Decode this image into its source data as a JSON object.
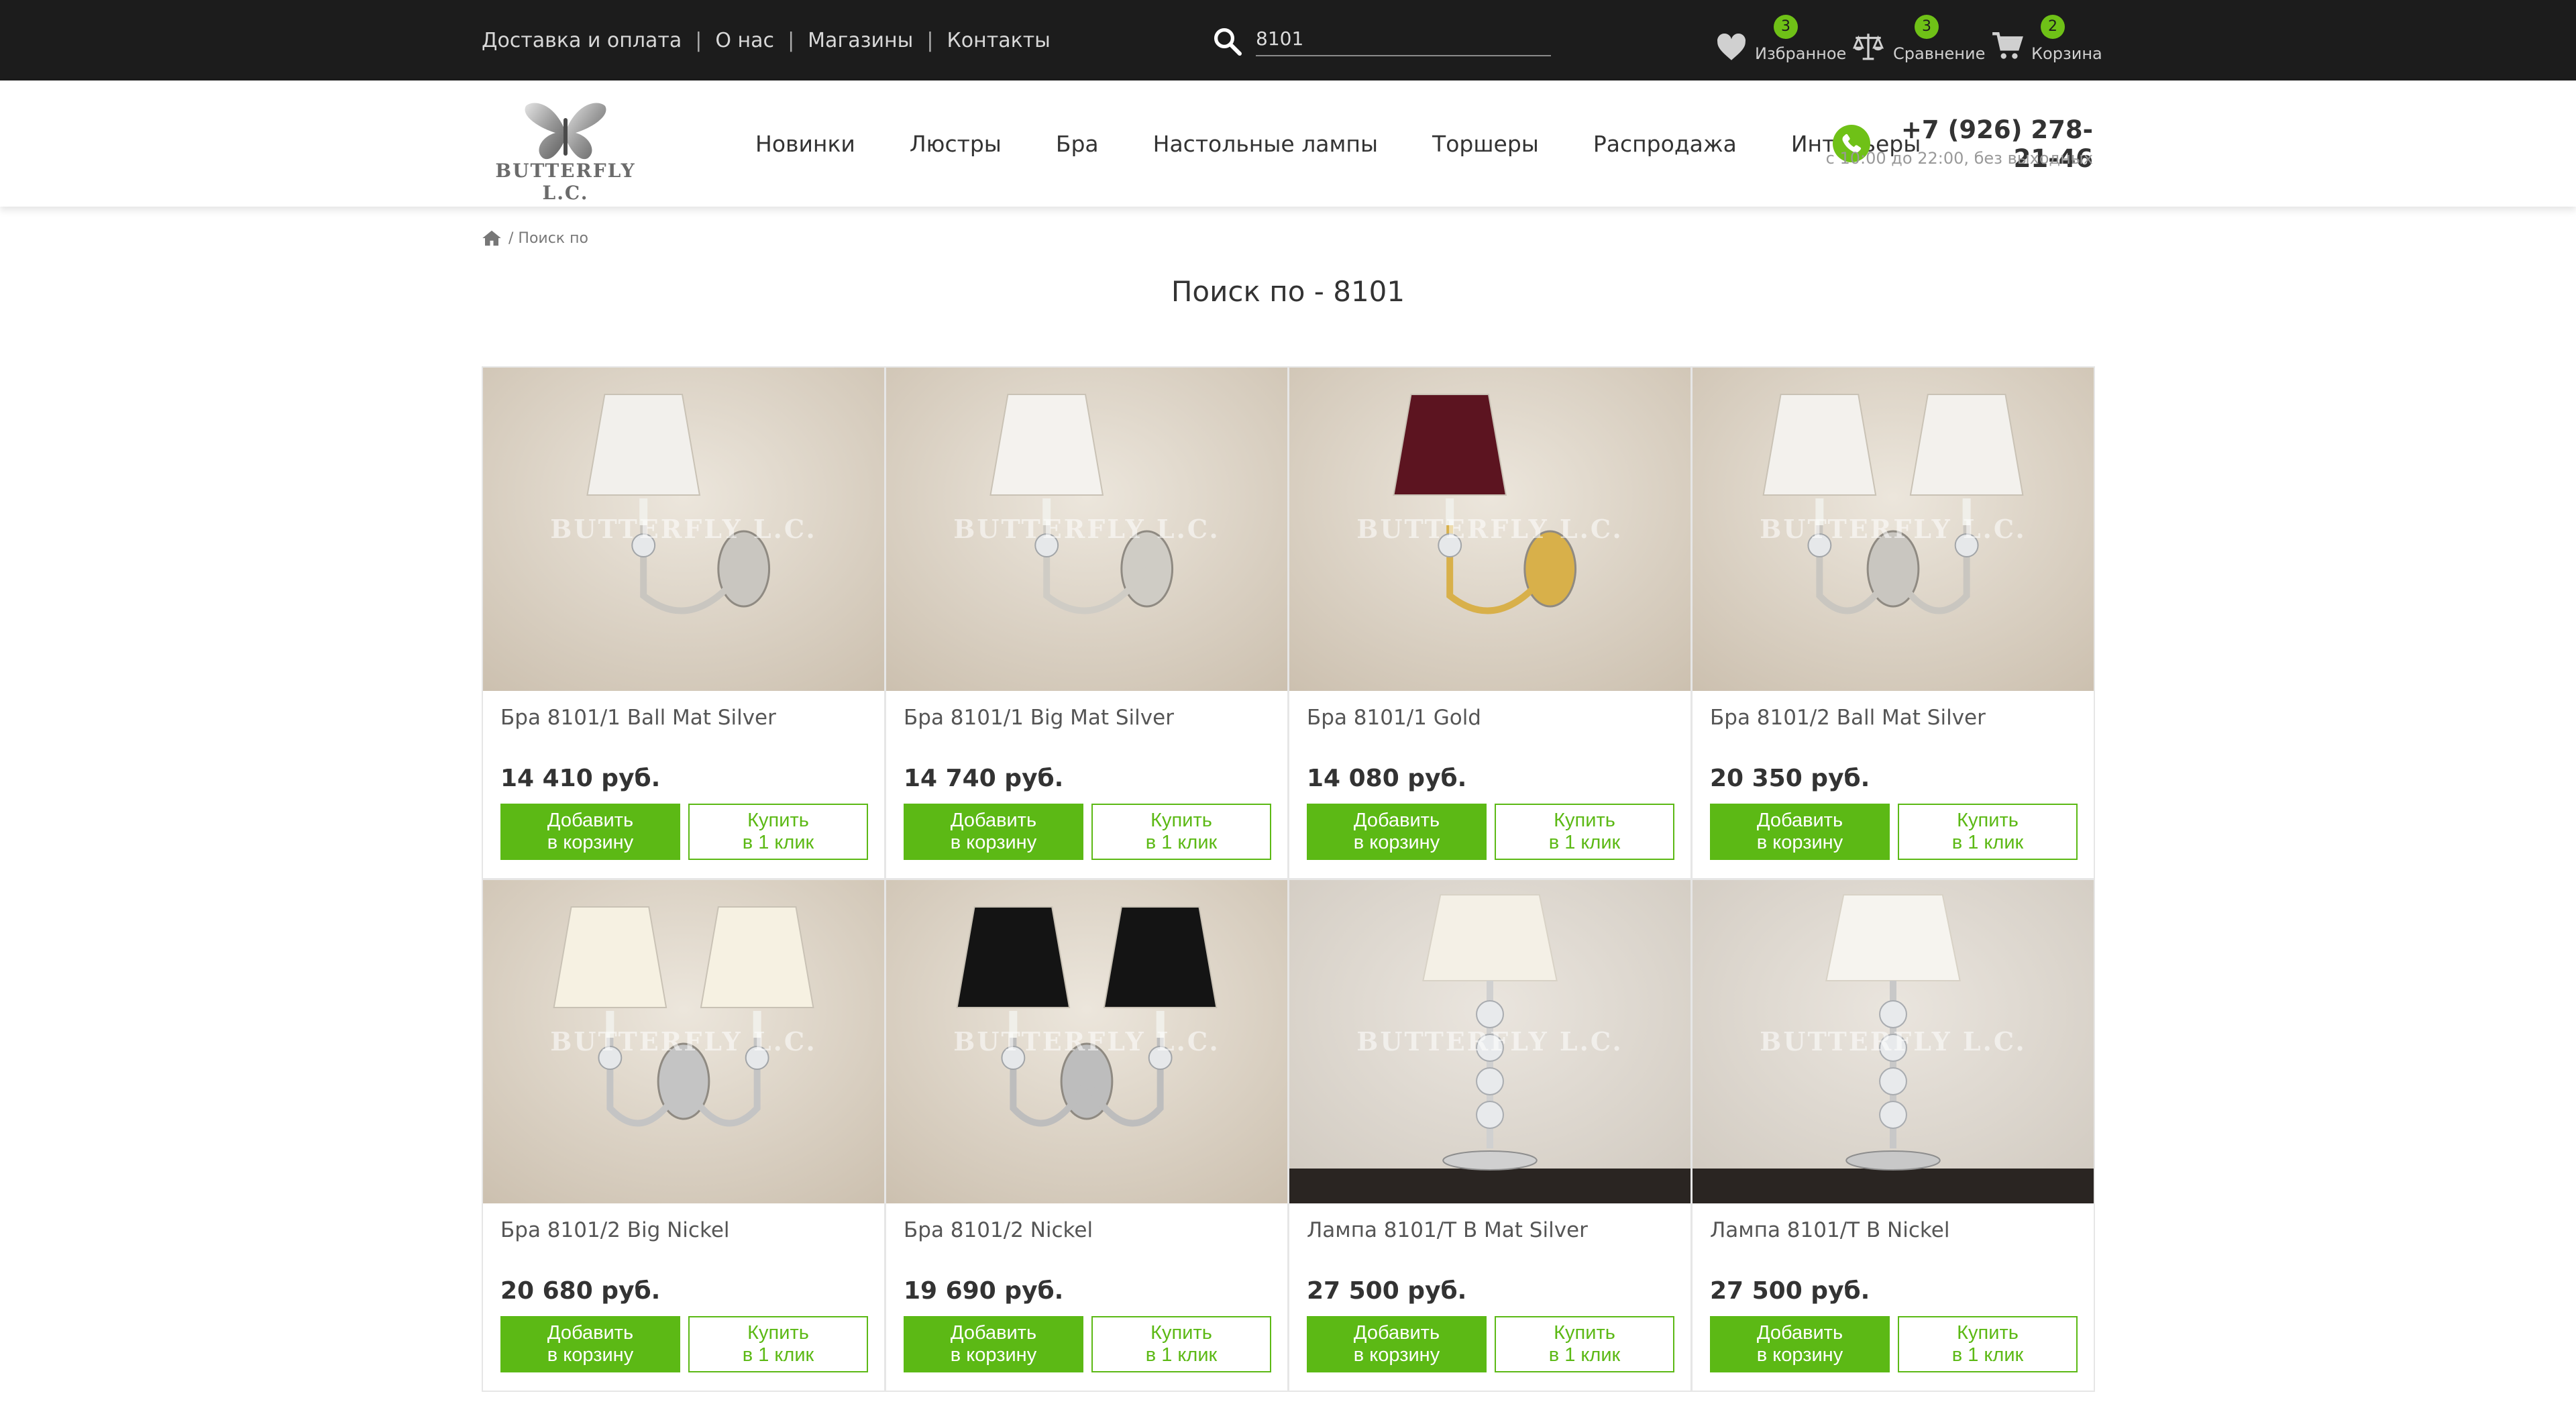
{
  "topbar": {
    "links": [
      "Доставка и оплата",
      "О нас",
      "Магазины",
      "Контакты"
    ],
    "search_value": "8101",
    "favorites": {
      "label": "Избранное",
      "count": "3"
    },
    "compare": {
      "label": "Сравнение",
      "count": "3"
    },
    "cart": {
      "label": "Корзина",
      "count": "2"
    }
  },
  "header": {
    "logo_text": "BUTTERFLY L.C.",
    "nav": [
      "Новинки",
      "Люстры",
      "Бра",
      "Настольные лампы",
      "Торшеры",
      "Распродажа",
      "Интерьеры"
    ],
    "phone": "+7 (926) 278-21-46",
    "hours": "с 10:00 до 22:00, без выходных"
  },
  "breadcrumb": {
    "current": "/ Поиск по"
  },
  "page_title": "Поиск по - 8101",
  "watermark": "BUTTERFLY L.C.",
  "buttons": {
    "add_line1": "Добавить",
    "add_line2": "в корзину",
    "buy_line1": "Купить",
    "buy_line2": "в 1 клик"
  },
  "products": [
    {
      "name": "Бра 8101/1 Ball Mat Silver",
      "price": "14 410 руб.",
      "shade": "#f2f0ec",
      "metal": "#c9c6c0",
      "arms": 1,
      "lamp_type": "sconce"
    },
    {
      "name": "Бра 8101/1 Big Mat Silver",
      "price": "14 740 руб.",
      "shade": "#f4f2ee",
      "metal": "#cfccc5",
      "arms": 1,
      "lamp_type": "sconce"
    },
    {
      "name": "Бра 8101/1 Gold",
      "price": "14 080 руб.",
      "shade": "#5c1420",
      "metal": "#d8b04a",
      "arms": 1,
      "lamp_type": "sconce"
    },
    {
      "name": "Бра 8101/2 Ball Mat Silver",
      "price": "20 350 руб.",
      "shade": "#f3f1ed",
      "metal": "#c9c6c0",
      "arms": 2,
      "lamp_type": "sconce"
    },
    {
      "name": "Бра 8101/2 Big Nickel",
      "price": "20 680 руб.",
      "shade": "#f6f1e2",
      "metal": "#c4c4c4",
      "arms": 2,
      "lamp_type": "sconce"
    },
    {
      "name": "Бра 8101/2 Nickel",
      "price": "19 690 руб.",
      "shade": "#141414",
      "metal": "#bdbdbd",
      "arms": 2,
      "lamp_type": "sconce"
    },
    {
      "name": "Лампа 8101/T B Mat Silver",
      "price": "27 500 руб.",
      "shade": "#f4f0e6",
      "metal": "#d0d0d0",
      "arms": 1,
      "lamp_type": "table"
    },
    {
      "name": "Лампа 8101/T B Nickel",
      "price": "27 500 руб.",
      "shade": "#f6f4ef",
      "metal": "#c8c8c8",
      "arms": 1,
      "lamp_type": "table"
    }
  ]
}
